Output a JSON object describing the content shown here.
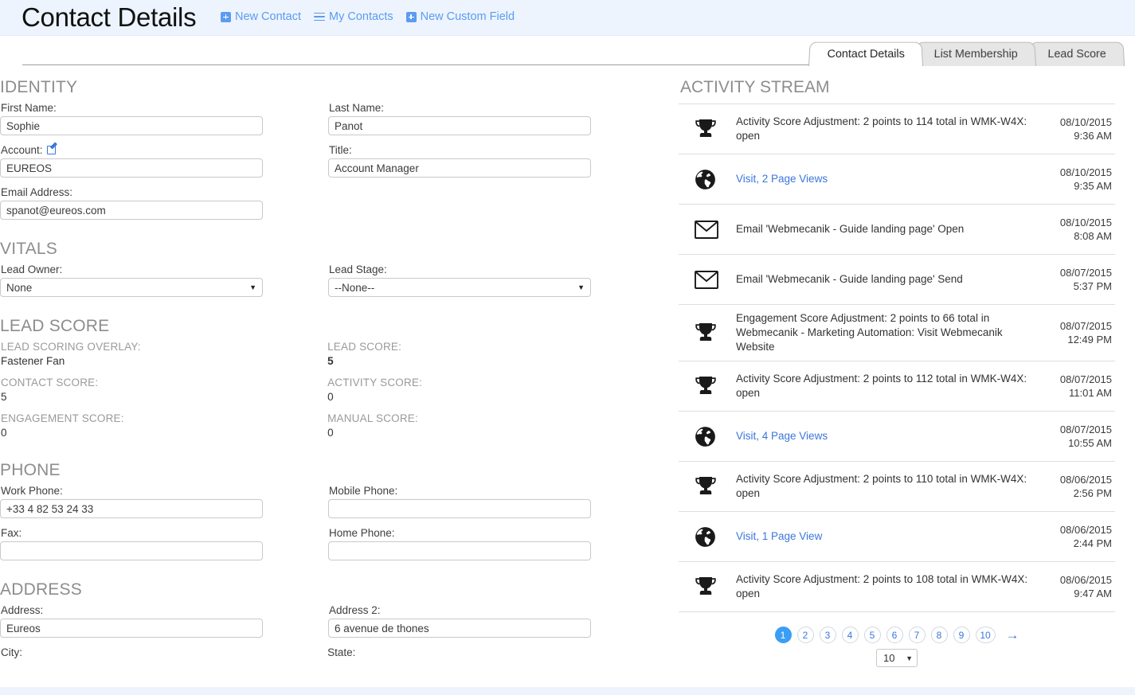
{
  "header": {
    "title": "Contact Details",
    "actions": [
      {
        "label": "New Contact",
        "icon": "plus-icon"
      },
      {
        "label": "My Contacts",
        "icon": "list-icon"
      },
      {
        "label": "New Custom Field",
        "icon": "plus-icon"
      }
    ]
  },
  "tabs": [
    {
      "label": "Contact Details",
      "active": true
    },
    {
      "label": "List Membership",
      "active": false
    },
    {
      "label": "Lead Score",
      "active": false
    }
  ],
  "sections": {
    "identity": {
      "title": "IDENTITY",
      "first_name_label": "First Name:",
      "first_name_value": "Sophie",
      "last_name_label": "Last Name:",
      "last_name_value": "Panot",
      "account_label": "Account:",
      "account_value": "EUREOS",
      "title_label": "Title:",
      "title_value": "Account Manager",
      "email_label": "Email Address:",
      "email_value": "spanot@eureos.com"
    },
    "vitals": {
      "title": "VITALS",
      "lead_owner_label": "Lead Owner:",
      "lead_owner_value": "None",
      "lead_stage_label": "Lead Stage:",
      "lead_stage_value": "--None--"
    },
    "lead_score": {
      "title": "LEAD SCORE",
      "overlay_label": "LEAD SCORING OVERLAY:",
      "overlay_value": "Fastener Fan",
      "lead_score_label": "LEAD SCORE:",
      "lead_score_value": "5",
      "contact_score_label": "CONTACT SCORE:",
      "contact_score_value": "5",
      "activity_score_label": "ACTIVITY SCORE:",
      "activity_score_value": "0",
      "engagement_score_label": "ENGAGEMENT SCORE:",
      "engagement_score_value": "0",
      "manual_score_label": "MANUAL SCORE:",
      "manual_score_value": "0"
    },
    "phone": {
      "title": "PHONE",
      "work_label": "Work Phone:",
      "work_value": "+33 4 82 53 24 33",
      "mobile_label": "Mobile Phone:",
      "mobile_value": "",
      "fax_label": "Fax:",
      "fax_value": "",
      "home_label": "Home Phone:",
      "home_value": ""
    },
    "address": {
      "title": "ADDRESS",
      "address_label": "Address:",
      "address_value": "Eureos",
      "address2_label": "Address 2:",
      "address2_value": "6 avenue de thones",
      "city_label": "City:",
      "state_label": "State:"
    }
  },
  "activity_stream": {
    "title": "ACTIVITY STREAM",
    "items": [
      {
        "icon": "trophy-icon",
        "text": "Activity Score Adjustment: 2 points to 114 total in WMK-W4X: open",
        "link": false,
        "date": "08/10/2015",
        "time": "9:36 AM"
      },
      {
        "icon": "globe-icon",
        "text": "Visit, 2 Page Views",
        "link": true,
        "date": "08/10/2015",
        "time": "9:35 AM"
      },
      {
        "icon": "envelope-icon",
        "text": "Email 'Webmecanik - Guide landing page' Open",
        "link": false,
        "date": "08/10/2015",
        "time": "8:08 AM"
      },
      {
        "icon": "envelope-icon",
        "text": "Email 'Webmecanik - Guide landing page' Send",
        "link": false,
        "date": "08/07/2015",
        "time": "5:37 PM"
      },
      {
        "icon": "trophy-icon",
        "text": "Engagement Score Adjustment: 2 points to 66 total in Webmecanik - Marketing Automation: Visit Webmecanik Website",
        "link": false,
        "date": "08/07/2015",
        "time": "12:49 PM"
      },
      {
        "icon": "trophy-icon",
        "text": "Activity Score Adjustment: 2 points to 112 total in WMK-W4X: open",
        "link": false,
        "date": "08/07/2015",
        "time": "11:01 AM"
      },
      {
        "icon": "globe-icon",
        "text": "Visit, 4 Page Views",
        "link": true,
        "date": "08/07/2015",
        "time": "10:55 AM"
      },
      {
        "icon": "trophy-icon",
        "text": "Activity Score Adjustment: 2 points to 110 total in WMK-W4X: open",
        "link": false,
        "date": "08/06/2015",
        "time": "2:56 PM"
      },
      {
        "icon": "globe-icon",
        "text": "Visit, 1 Page View",
        "link": true,
        "date": "08/06/2015",
        "time": "2:44 PM"
      },
      {
        "icon": "trophy-icon",
        "text": "Activity Score Adjustment: 2 points to 108 total in WMK-W4X: open",
        "link": false,
        "date": "08/06/2015",
        "time": "9:47 AM"
      }
    ],
    "pager": {
      "pages": [
        "1",
        "2",
        "3",
        "4",
        "5",
        "6",
        "7",
        "8",
        "9",
        "10"
      ],
      "active_page": "1",
      "next_arrow": "→",
      "per_page_value": "10"
    }
  },
  "colors": {
    "header_bg": "#edf4fd",
    "link_blue": "#5b9bf2",
    "accent_blue": "#3b9ef5",
    "section_gray": "#8d8d8d"
  }
}
